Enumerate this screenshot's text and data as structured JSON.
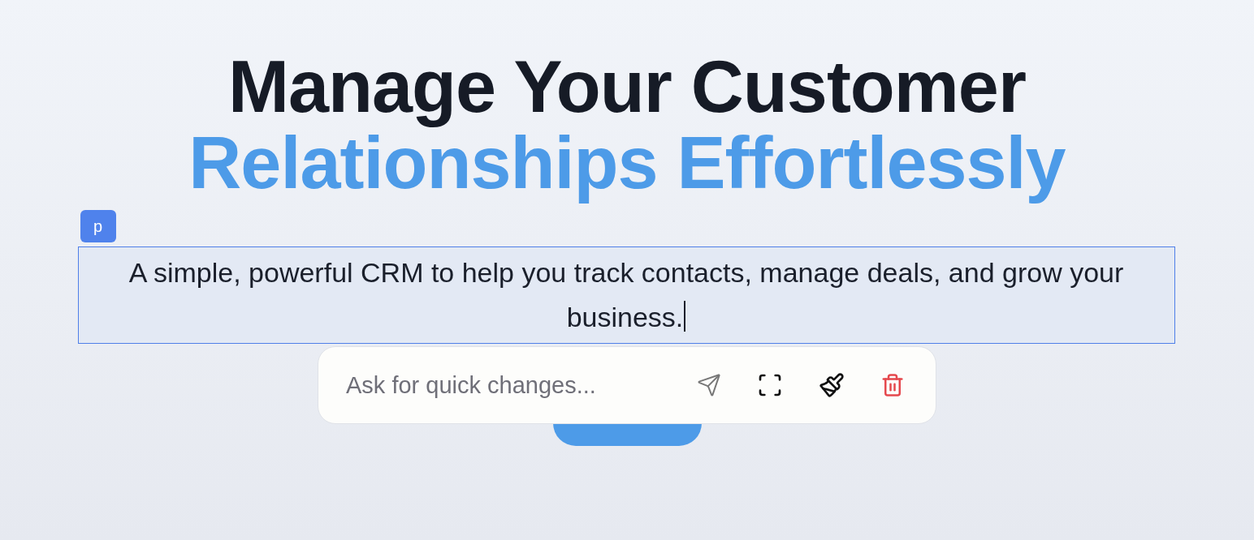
{
  "heading": {
    "line_1": "Manage Your Customer",
    "line_2": "Relationships Effortlessly"
  },
  "selected_element": {
    "tag": "p",
    "text": "A simple, powerful CRM to help you track contacts, manage deals, and grow your business."
  },
  "quick_edit": {
    "placeholder": "Ask for quick changes..."
  }
}
